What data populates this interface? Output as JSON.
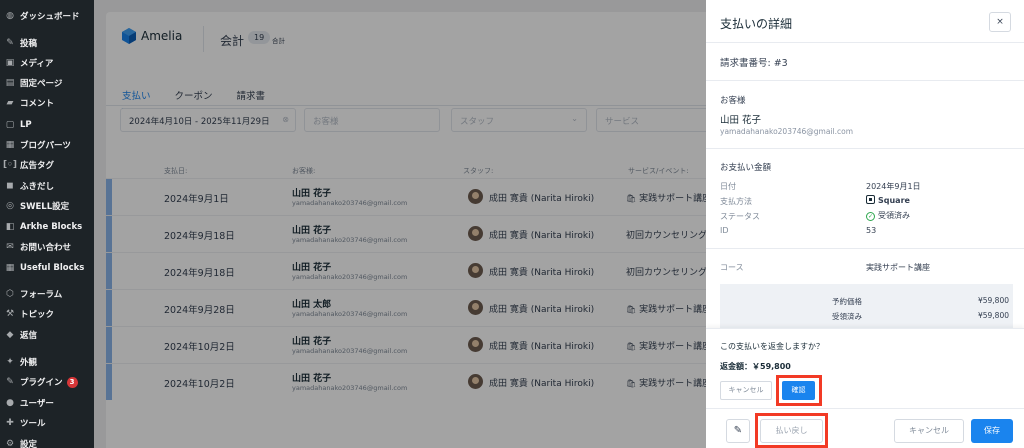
{
  "colors": {
    "accent": "#1a84ee",
    "highlight": "#f23a25",
    "wp_sidebar": "#1d2327",
    "success": "#2fa84f"
  },
  "wp_menu": [
    {
      "icon": "dashboard-icon",
      "glyph": "◍",
      "label": "ダッシュボード"
    },
    {
      "icon": "pin-icon",
      "glyph": "✎",
      "label": "投稿"
    },
    {
      "icon": "media-icon",
      "glyph": "▣",
      "label": "メディア"
    },
    {
      "icon": "page-icon",
      "glyph": "▤",
      "label": "固定ページ"
    },
    {
      "icon": "comment-icon",
      "glyph": "▰",
      "label": "コメント"
    },
    {
      "icon": "lp-icon",
      "glyph": "▢",
      "label": "LP"
    },
    {
      "icon": "blog-parts-icon",
      "glyph": "▦",
      "label": "ブログパーツ"
    },
    {
      "icon": "ad-tag-icon",
      "glyph": "[◦]",
      "label": "広告タグ"
    },
    {
      "icon": "balloon-icon",
      "glyph": "◼",
      "label": "ふきだし"
    },
    {
      "icon": "swell-icon",
      "glyph": "◎",
      "label": "SWELL設定"
    },
    {
      "icon": "arkhe-icon",
      "glyph": "◧",
      "label": "Arkhe Blocks"
    },
    {
      "icon": "mail-icon",
      "glyph": "✉",
      "label": "お問い合わせ"
    },
    {
      "icon": "useful-blocks-icon",
      "glyph": "▦",
      "label": "Useful Blocks"
    },
    {
      "icon": "forum-icon",
      "glyph": "⬡",
      "label": "フォーラム"
    },
    {
      "icon": "topic-icon",
      "glyph": "⚒",
      "label": "トピック"
    },
    {
      "icon": "reply-icon",
      "glyph": "◆",
      "label": "返信"
    },
    {
      "icon": "appearance-icon",
      "glyph": "✦",
      "label": "外観"
    },
    {
      "icon": "plugin-icon",
      "glyph": "✎",
      "label": "プラグイン",
      "badge": "3"
    },
    {
      "icon": "user-icon",
      "glyph": "●",
      "label": "ユーザー"
    },
    {
      "icon": "tool-icon",
      "glyph": "✚",
      "label": "ツール"
    },
    {
      "icon": "settings-icon",
      "glyph": "⚙",
      "label": "設定"
    }
  ],
  "header": {
    "app_name": "Amelia",
    "page_title": "会計",
    "count": "19",
    "count_label": "合計"
  },
  "tabs": [
    "支払い",
    "クーポン",
    "請求書"
  ],
  "filters": {
    "date_range": "2024年4月10日 - 2025年11月29日",
    "customer_placeholder": "お客様",
    "staff_placeholder": "スタッフ",
    "service_placeholder": "サービス"
  },
  "table": {
    "headers": {
      "date": "支払日:",
      "customer": "お客様:",
      "staff": "スタッフ:",
      "service": "サービス/イベント:"
    },
    "rows": [
      {
        "date": "2024年9月1日",
        "name": "山田 花子",
        "email": "yamadahanako203746@gmail.com",
        "staff": "成田 寛貴 (Narita Hiroki)",
        "service": "実践サポート講座",
        "bag": true
      },
      {
        "date": "2024年9月18日",
        "name": "山田 花子",
        "email": "yamadahanako203746@gmail.com",
        "staff": "成田 寛貴 (Narita Hiroki)",
        "service": "初回カウンセリング",
        "bag": false
      },
      {
        "date": "2024年9月18日",
        "name": "山田 花子",
        "email": "yamadahanako203746@gmail.com",
        "staff": "成田 寛貴 (Narita Hiroki)",
        "service": "初回カウンセリング",
        "bag": false
      },
      {
        "date": "2024年9月28日",
        "name": "山田 太郎",
        "email": "yamadahanako203746@gmail.com",
        "staff": "成田 寛貴 (Narita Hiroki)",
        "service": "実践サポート講座",
        "bag": true
      },
      {
        "date": "2024年10月2日",
        "name": "山田 花子",
        "email": "yamadahanako203746@gmail.com",
        "staff": "成田 寛貴 (Narita Hiroki)",
        "service": "実践サポート講座",
        "bag": true
      },
      {
        "date": "2024年10月2日",
        "name": "山田 花子",
        "email": "yamadahanako203746@gmail.com",
        "staff": "成田 寛貴 (Narita Hiroki)",
        "service": "実践サポート講座",
        "bag": true
      }
    ]
  },
  "drawer": {
    "title": "支払いの詳細",
    "close": "×",
    "invoice": "請求書番号: #3",
    "customer_heading": "お客様",
    "customer_name": "山田 花子",
    "customer_email": "yamadahanako203746@gmail.com",
    "amount_heading": "お支払い金額",
    "details": {
      "date_label": "日付",
      "date_value": "2024年9月1日",
      "method_label": "支払方法",
      "method_value": "Square",
      "status_label": "ステータス",
      "status_value": "受領済み",
      "id_label": "ID",
      "id_value": "53"
    },
    "course_label": "コース",
    "course_value": "実践サポート講座",
    "prices": [
      {
        "label": "予約価格",
        "value": "¥59,800"
      },
      {
        "label": "受領済み",
        "value": "¥59,800"
      }
    ],
    "refund": {
      "question": "この支払いを返金しますか？",
      "amount": "返金額：￥59,800",
      "cancel": "キャンセル",
      "confirm": "確認"
    },
    "footer": {
      "edit_icon": "pencil-icon",
      "refund": "払い戻し",
      "cancel": "キャンセル",
      "save": "保存"
    }
  }
}
